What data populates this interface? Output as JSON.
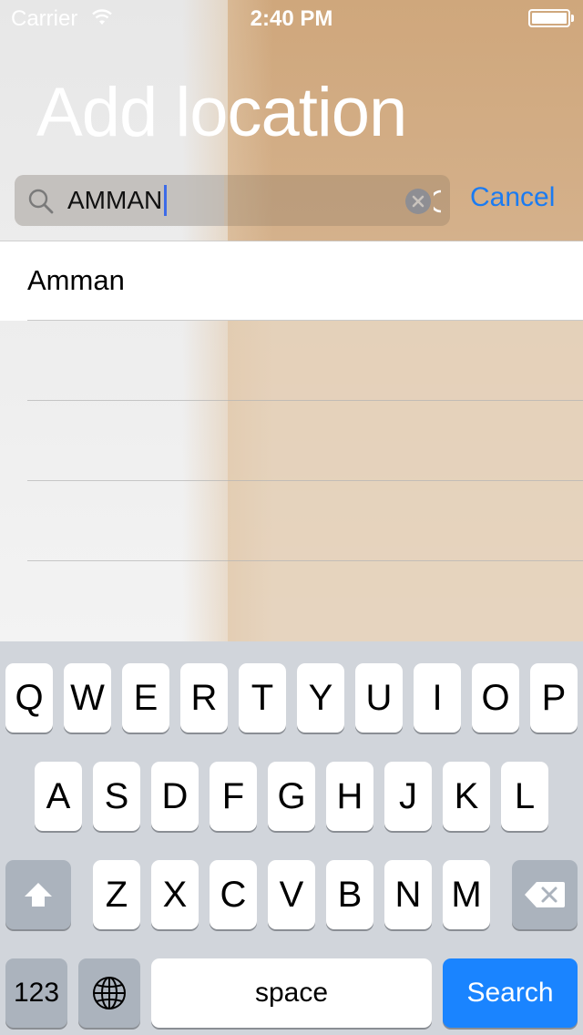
{
  "status_bar": {
    "carrier": "Carrier",
    "time": "2:40 PM"
  },
  "header": {
    "title": "Add location"
  },
  "search": {
    "value": "AMMAN",
    "cancel_label": "Cancel"
  },
  "results": [
    {
      "label": "Amman"
    }
  ],
  "keyboard": {
    "row1": [
      "Q",
      "W",
      "E",
      "R",
      "T",
      "Y",
      "U",
      "I",
      "O",
      "P"
    ],
    "row2": [
      "A",
      "S",
      "D",
      "F",
      "G",
      "H",
      "J",
      "K",
      "L"
    ],
    "row3": [
      "Z",
      "X",
      "C",
      "V",
      "B",
      "N",
      "M"
    ],
    "numbers_label": "123",
    "space_label": "space",
    "search_label": "Search",
    "icons": {
      "shift": "shift-icon",
      "backspace": "backspace-icon",
      "globe": "globe-icon"
    }
  },
  "colors": {
    "accent": "#1a7bf2",
    "search_key": "#1a84ff",
    "keyboard_bg": "#d1d5db"
  }
}
